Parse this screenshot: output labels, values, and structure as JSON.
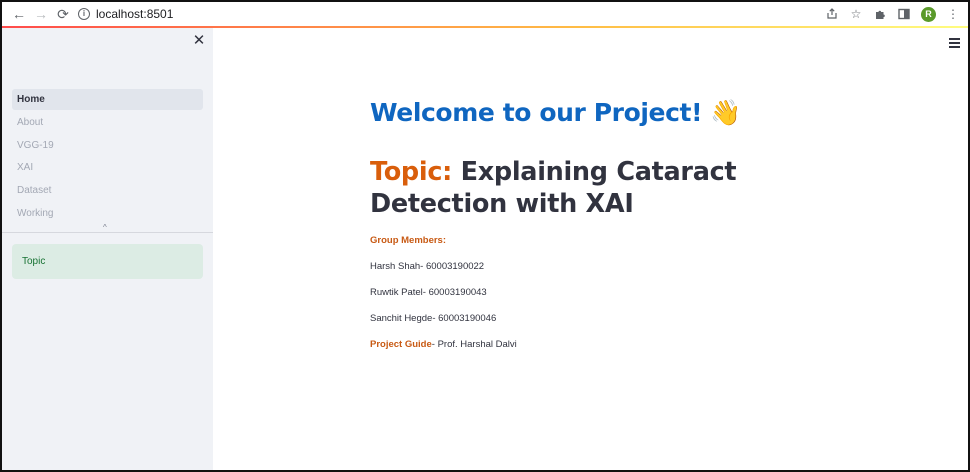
{
  "browser": {
    "url": "localhost:8501",
    "avatar_letter": "R",
    "icons": [
      "back-icon",
      "forward-icon",
      "reload-icon",
      "info-icon",
      "share-icon",
      "star-icon",
      "extensions-icon",
      "side-panel-icon",
      "kebab-menu-icon"
    ]
  },
  "sidebar": {
    "items": [
      {
        "label": "Home",
        "active": true
      },
      {
        "label": "About",
        "active": false
      },
      {
        "label": "VGG-19",
        "active": false
      },
      {
        "label": "XAI",
        "active": false
      },
      {
        "label": "Dataset",
        "active": false
      },
      {
        "label": "Working",
        "active": false
      }
    ],
    "section": "Topic"
  },
  "main": {
    "welcome": "Welcome to our Project!",
    "wave_emoji": "👋",
    "topic_label": "Topic:",
    "topic_text": " Explaining Cataract Detection with XAI",
    "members_label": "Group Members:",
    "members": [
      "Harsh Shah- 60003190022",
      "Ruwtik Patel- 60003190043",
      "Sanchit Hegde- 60003190046"
    ],
    "guide_label": "Project Guide",
    "guide_text": "- Prof. Harshal Dalvi"
  },
  "colors": {
    "accent_blue": "#0f66c0",
    "accent_orange": "#d95e0b",
    "sidebar_bg": "#f0f2f6",
    "topic_box_bg": "#dcece4",
    "topic_box_text": "#177233"
  }
}
